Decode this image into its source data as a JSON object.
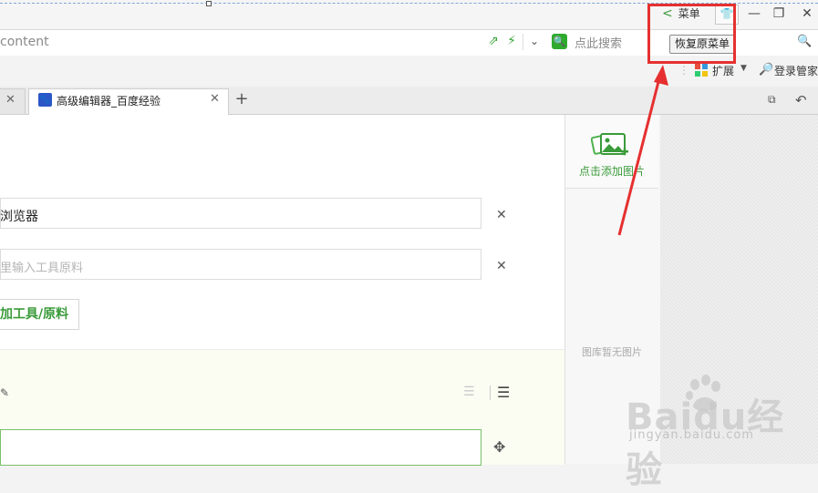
{
  "window": {
    "menu_toggle": "菜单",
    "skin_icon": "tshirt-icon",
    "minimize": "—",
    "maximize": "❐",
    "close": "✕"
  },
  "address_bar": {
    "url_value": "content",
    "search_placeholder": "点此搜索",
    "restore_menu_button": "恢复原菜单"
  },
  "toolbar": {
    "extensions_label": "扩展",
    "login_label": "登录管家"
  },
  "tabs": [
    {
      "label": "",
      "active": false
    },
    {
      "label": "高级编辑器_百度经验",
      "active": true
    }
  ],
  "editor": {
    "tool_1_value": "浏览器",
    "tool_2_placeholder": "里输入工具原料",
    "add_tool_button": "加工具/原料"
  },
  "sidebar": {
    "add_image_label": "点击添加图片",
    "empty_text": "图库暂无图片"
  },
  "watermark": {
    "brand": "Baidu经验",
    "domain": "jingyan.baidu.com"
  },
  "colors": {
    "accent_green": "#3a9b3a",
    "annotation_red": "#e63030"
  }
}
